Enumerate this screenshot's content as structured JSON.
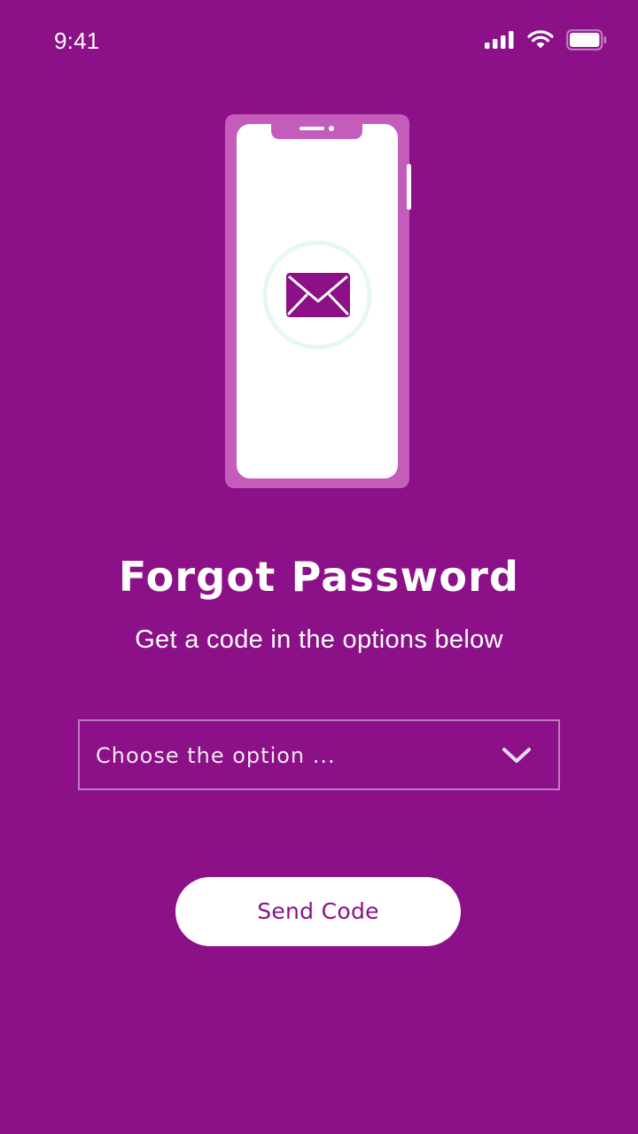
{
  "status_bar": {
    "time": "9:41",
    "icons": [
      "signal-icon",
      "wifi-icon",
      "battery-icon"
    ]
  },
  "illustration": {
    "icon": "mail-icon"
  },
  "title": "Forgot Password",
  "subtitle": "Get a code in the options below",
  "dropdown": {
    "placeholder": "Choose the option ...",
    "icon": "chevron-down-icon"
  },
  "send_button": {
    "label": "Send Code"
  },
  "colors": {
    "background": "#8c1087",
    "phone_frame": "#c45cbb",
    "accent": "#8c1087",
    "mail_ring": "#e6f7f8"
  }
}
